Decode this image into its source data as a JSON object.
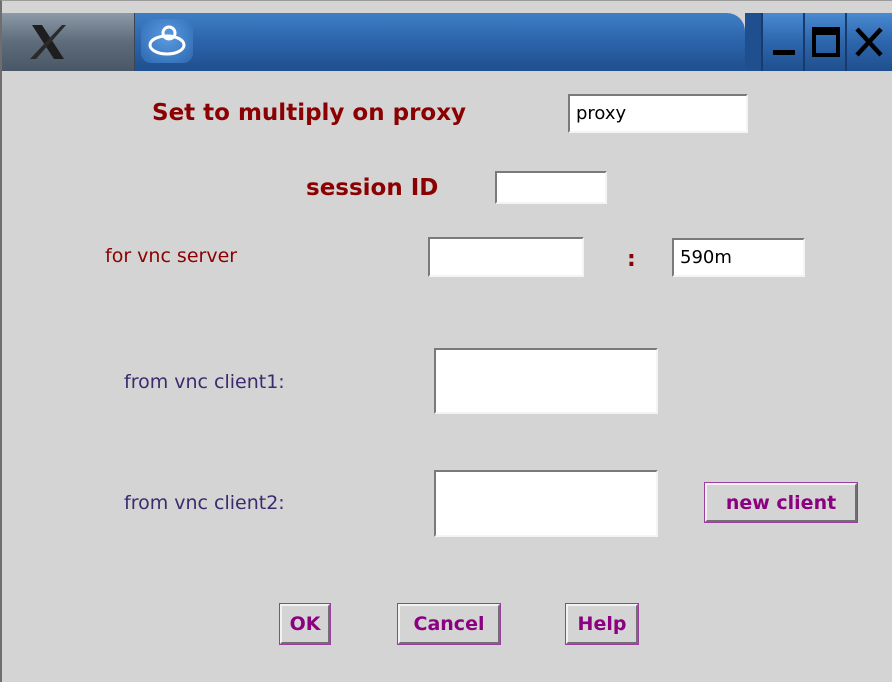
{
  "window": {
    "titlebar_icons": [
      "x-logo-icon",
      "java-logo-icon",
      "minimize-icon",
      "maximize-icon",
      "close-icon"
    ]
  },
  "form": {
    "proxy_label": "Set to multiply on proxy",
    "proxy_value": "proxy",
    "session_label": "session ID",
    "session_value": "",
    "server_label": "for vnc server",
    "server_host_value": "",
    "server_separator": ":",
    "server_port_value": "590m",
    "client1_label": "from vnc client1:",
    "client1_value": "",
    "client2_label": "from vnc client2:",
    "client2_value": ""
  },
  "buttons": {
    "new_client": "new client",
    "ok": "OK",
    "cancel": "Cancel",
    "help": "Help"
  },
  "colors": {
    "label_dark_red": "#8b0000",
    "label_purple": "#3b2a6e",
    "button_text": "#8b0080",
    "titlebar_blue": "#2d66ad",
    "background": "#d4d4d4"
  }
}
